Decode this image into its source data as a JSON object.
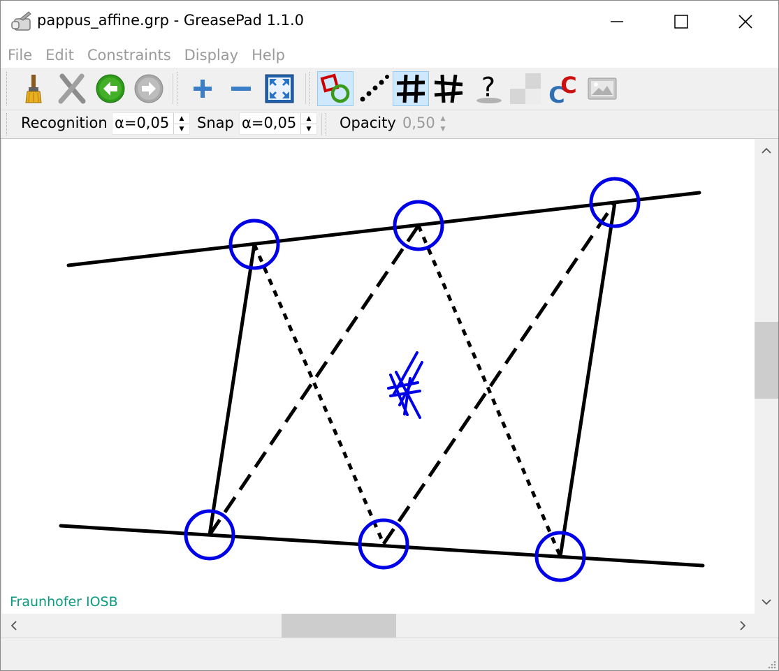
{
  "window": {
    "title": "pappus_affine.grp - GreasePad 1.1.0",
    "icon": "greasepad-app-icon"
  },
  "menu": {
    "items": [
      "File",
      "Edit",
      "Constraints",
      "Display",
      "Help"
    ]
  },
  "toolbar": {
    "icons": [
      "broom-icon",
      "delete-x-icon",
      "undo-arrow-icon",
      "redo-arrow-icon",
      "zoom-in-plus-icon",
      "zoom-out-minus-icon",
      "fit-view-icon",
      "show-constraints-icon",
      "show-uncertainty-icon",
      "show-elements-icon",
      "show-constraints-markers-icon",
      "help-question-icon",
      "colors-icon",
      "consistency-c-icon",
      "screenshot-icon"
    ]
  },
  "options": {
    "recognition_label": "Recognition",
    "recognition_value": "α=0,05",
    "snap_label": "Snap",
    "snap_value": "α=0,05",
    "opacity_label": "Opacity",
    "opacity_value": "0,50"
  },
  "canvas": {
    "credit": "Fraunhofer IOSB"
  },
  "colors": {
    "point_circle": "#0000e6",
    "stroke": "#000000",
    "credit": "#0a9a80",
    "highlight": "#cde8ff"
  }
}
